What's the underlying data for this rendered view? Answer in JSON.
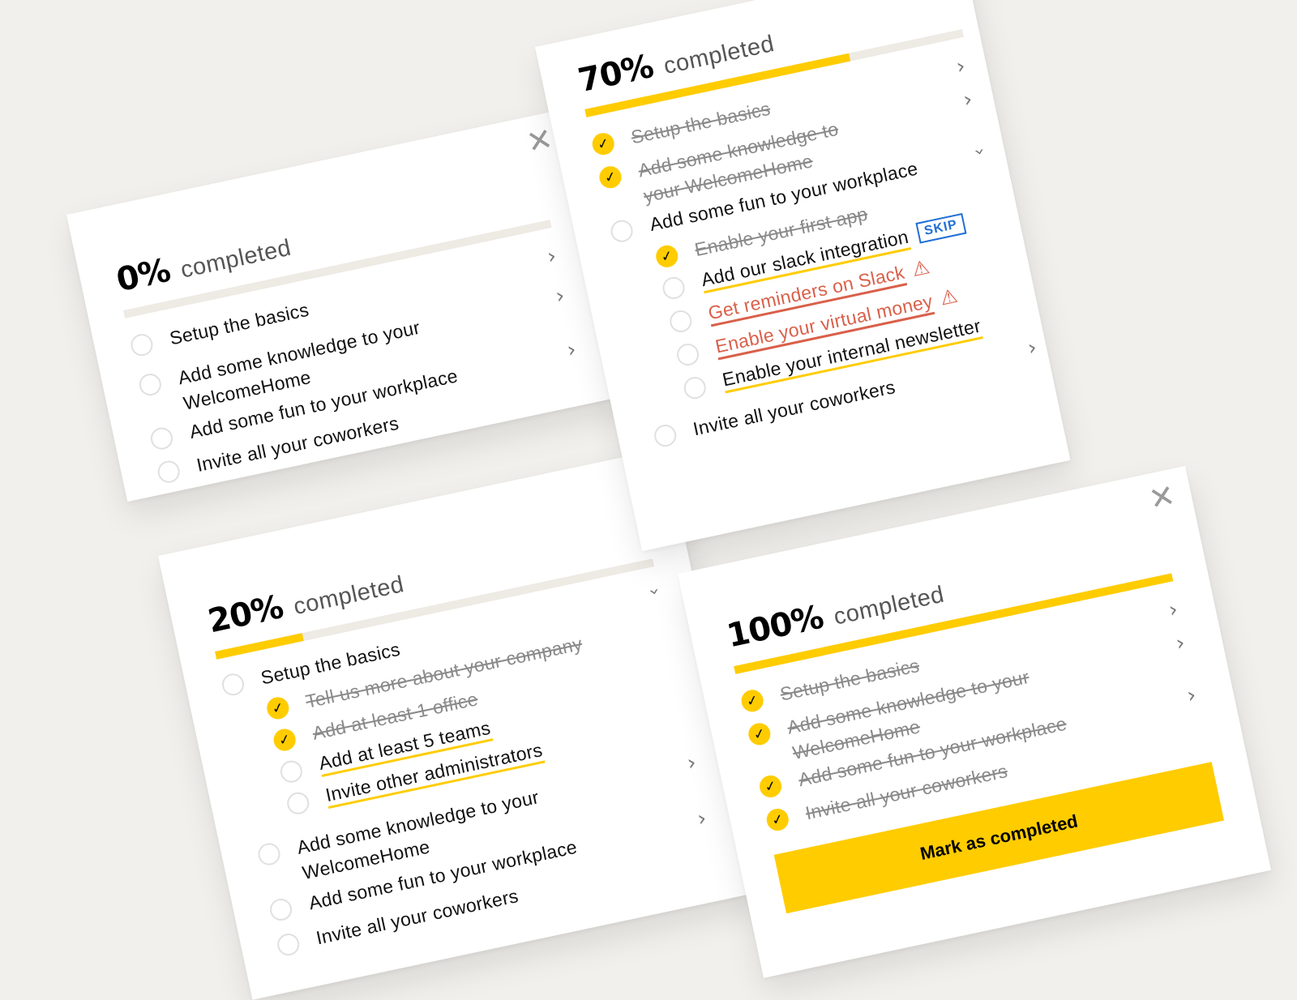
{
  "cards": {
    "c0": {
      "percent": "0%",
      "completed": "completed",
      "progress": 0,
      "close": "✕",
      "items": [
        {
          "label": "Setup the basics"
        },
        {
          "label": "Add some knowledge to your WelcomeHome"
        },
        {
          "label": "Add some fun to your workplace"
        },
        {
          "label": "Invite all your coworkers"
        }
      ]
    },
    "c20": {
      "percent": "20%",
      "completed": "completed",
      "progress": 0.2,
      "close": "✕",
      "items": [
        {
          "label": "Setup the basics"
        },
        {
          "label": "Tell us more about your company"
        },
        {
          "label": "Add at least 1 office"
        },
        {
          "label": "Add at least 5 teams"
        },
        {
          "label": "Invite other administrators"
        },
        {
          "label": "Add some knowledge to your WelcomeHome"
        },
        {
          "label": "Add some fun to your workplace"
        },
        {
          "label": "Invite all your coworkers"
        }
      ]
    },
    "c70": {
      "percent": "70%",
      "completed": "completed",
      "progress": 0.7,
      "items": [
        {
          "label": "Setup the basics"
        },
        {
          "label": "Add some knowledge to your WelcomeHome"
        },
        {
          "label": "Add some fun to your workplace"
        },
        {
          "label": "Enable your first app"
        },
        {
          "label": "Add our slack integration"
        },
        {
          "label": "Get reminders on Slack"
        },
        {
          "label": "Enable your virtual money"
        },
        {
          "label": "Enable your internal newsletter"
        },
        {
          "label": "Invite all your coworkers"
        }
      ],
      "skip": "SKIP"
    },
    "c100": {
      "percent": "100%",
      "completed": "completed",
      "progress": 1,
      "close": "✕",
      "items": [
        {
          "label": "Setup the basics"
        },
        {
          "label": "Add some knowledge to your WelcomeHome"
        },
        {
          "label": "Add some fun to your workplace"
        },
        {
          "label": "Invite all your coworkers"
        }
      ],
      "cta": "Mark as completed"
    }
  },
  "colors": {
    "accent": "#ffcc00",
    "warning": "#d9604a",
    "link": "#1f6fd6"
  }
}
